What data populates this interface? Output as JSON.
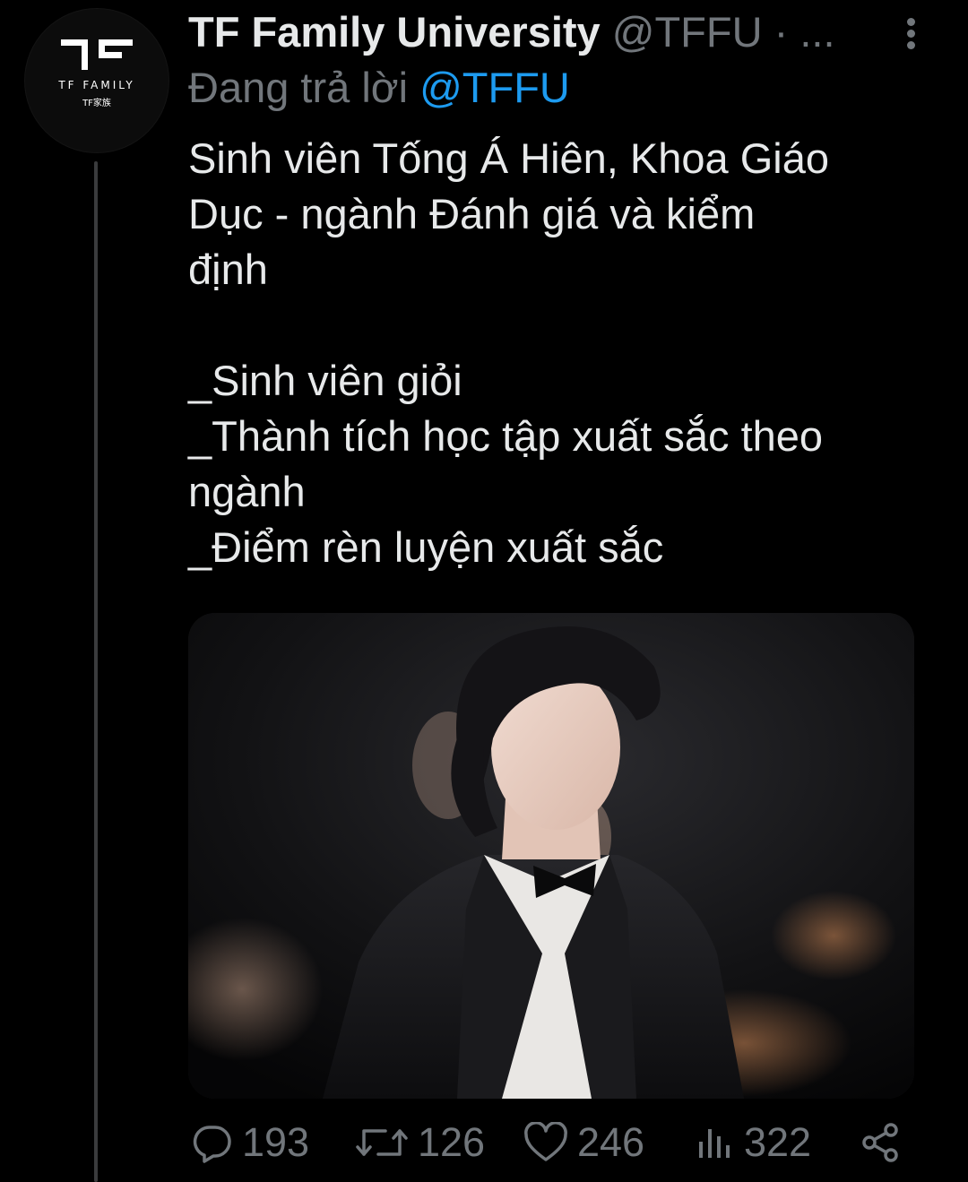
{
  "account": {
    "avatar_brand": "TF FAMILY",
    "avatar_brand_cn": "TF家族"
  },
  "header": {
    "display_name": "TF Family University",
    "handle": "@TFFU",
    "separator": "·",
    "time": "..."
  },
  "reply": {
    "prefix": "Đang trả lời",
    "mention": "@TFFU"
  },
  "tweet": {
    "lines": [
      "Sinh viên Tống Á Hiên, Khoa Giáo",
      "Dục - ngành Đánh giá và kiểm",
      "định",
      "",
      "_Sinh viên giỏi",
      "_Thành tích học tập xuất sắc theo",
      "ngành",
      "_Điểm rèn luyện xuất sắc"
    ]
  },
  "actions": {
    "replies": "193",
    "retweets": "126",
    "likes": "246",
    "views": "322"
  },
  "icons": {
    "more": "more-vertical-icon",
    "reply": "reply-icon",
    "retweet": "retweet-icon",
    "like": "heart-icon",
    "views": "views-icon",
    "share": "share-icon"
  },
  "colors": {
    "background": "#000000",
    "text": "#e7e9ea",
    "muted": "#71767b",
    "link": "#1d9bf0",
    "thread_line": "#3a3b3d"
  }
}
